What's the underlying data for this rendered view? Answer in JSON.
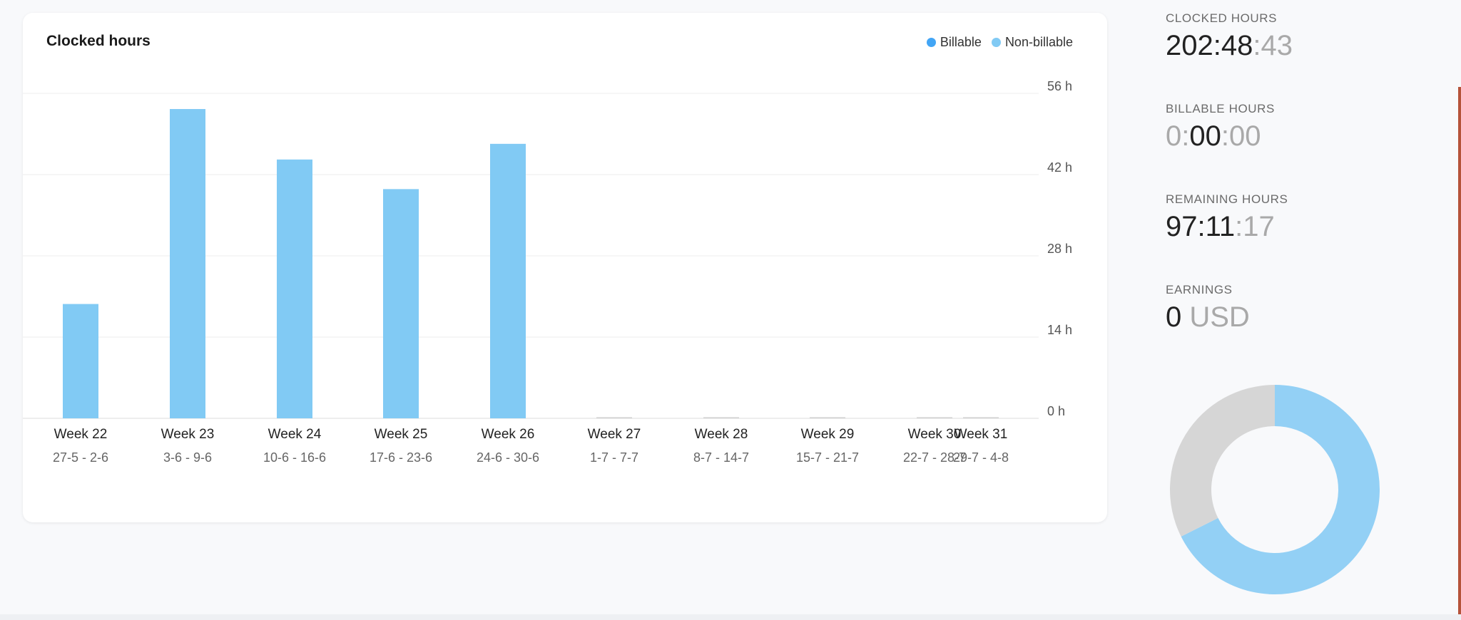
{
  "card": {
    "title": "Clocked hours",
    "legend": [
      {
        "label": "Billable",
        "color": "#42a5f5"
      },
      {
        "label": "Non-billable",
        "color": "#81caf4"
      }
    ]
  },
  "chart_data": {
    "type": "bar",
    "title": "Clocked hours",
    "categories": [
      "Week 22",
      "Week 23",
      "Week 24",
      "Week 25",
      "Week 26",
      "Week 27",
      "Week 28",
      "Week 29",
      "Week 30",
      "Week 31"
    ],
    "date_ranges": [
      "27-5 - 2-6",
      "3-6 - 9-6",
      "10-6 - 16-6",
      "17-6 - 23-6",
      "24-6 - 30-6",
      "1-7 - 7-7",
      "8-7 - 14-7",
      "15-7 - 21-7",
      "22-7 - 28-7",
      "29-7 - 4-8"
    ],
    "series": [
      {
        "name": "Billable",
        "color": "#42a5f5",
        "values": [
          0,
          0,
          0,
          0,
          0,
          0,
          0,
          0,
          0,
          0
        ]
      },
      {
        "name": "Non-billable",
        "color": "#81caf4",
        "values": [
          19.7,
          53.3,
          44.6,
          39.5,
          47.3,
          0,
          0,
          0,
          0,
          0
        ]
      }
    ],
    "y_ticks": [
      "56 h",
      "42 h",
      "28 h",
      "14 h",
      "0 h"
    ],
    "ylim": [
      0,
      56
    ],
    "legend_position": "top-right",
    "grid": true
  },
  "stats": {
    "clocked": {
      "label": "CLOCKED HOURS",
      "main": "202:48",
      "sec": ":43"
    },
    "billable": {
      "label": "BILLABLE HOURS",
      "pre": "0:",
      "main": "00",
      "sec": ":00"
    },
    "remaining": {
      "label": "REMAINING HOURS",
      "main": "97:11",
      "sec": ":17"
    },
    "earnings": {
      "label": "EARNINGS",
      "main": "0",
      "sec": " USD"
    }
  },
  "donut": {
    "segments": [
      {
        "name": "clocked",
        "value": 202.81,
        "color": "#93d0f5"
      },
      {
        "name": "remaining",
        "value": 97.19,
        "color": "#d6d6d6"
      }
    ]
  }
}
